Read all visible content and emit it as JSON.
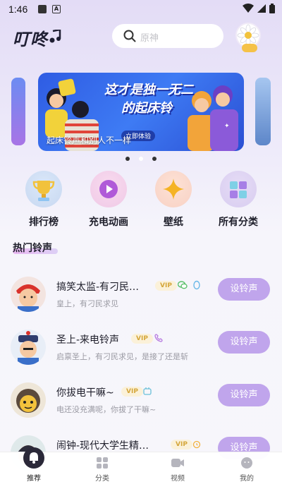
{
  "status": {
    "time": "1:46"
  },
  "header": {
    "logo": "叮咚",
    "search_placeholder": "原神"
  },
  "banner": {
    "title_line1": "这才是独一无二",
    "title_line2": "的起床铃",
    "tag": "立即体验",
    "caption": "起床铃声和别人不一样"
  },
  "categories": [
    {
      "label": "排行榜",
      "icon": "trophy-icon"
    },
    {
      "label": "充电动画",
      "icon": "play-icon"
    },
    {
      "label": "壁纸",
      "icon": "star-icon"
    },
    {
      "label": "所有分类",
      "icon": "grid-icon"
    }
  ],
  "section": {
    "title": "热门铃声"
  },
  "songs": [
    {
      "title": "搞笑太监-有刁民…",
      "desc": "皇上，有刁民求见",
      "vip": "VIP",
      "button": "设铃声"
    },
    {
      "title": "圣上-来电铃声",
      "desc": "启禀圣上，有刁民求见，是接了还是斩",
      "vip": "VIP",
      "button": "设铃声"
    },
    {
      "title": "你拔电干嘛~",
      "desc": "电还没充满呢，你拔了干嘛~",
      "vip": "VIP",
      "button": "设铃声"
    },
    {
      "title": "闹钟-现代大学生精…",
      "desc": "",
      "vip": "VIP",
      "button": "设铃声"
    }
  ],
  "tabs": [
    {
      "label": "推荐",
      "active": true
    },
    {
      "label": "分类",
      "active": false
    },
    {
      "label": "视频",
      "active": false
    },
    {
      "label": "我的",
      "active": false
    }
  ],
  "colors": {
    "accent": "#c0a5ec",
    "vip_text": "#d4a63a",
    "banner_blue": "#3e7bf4"
  }
}
